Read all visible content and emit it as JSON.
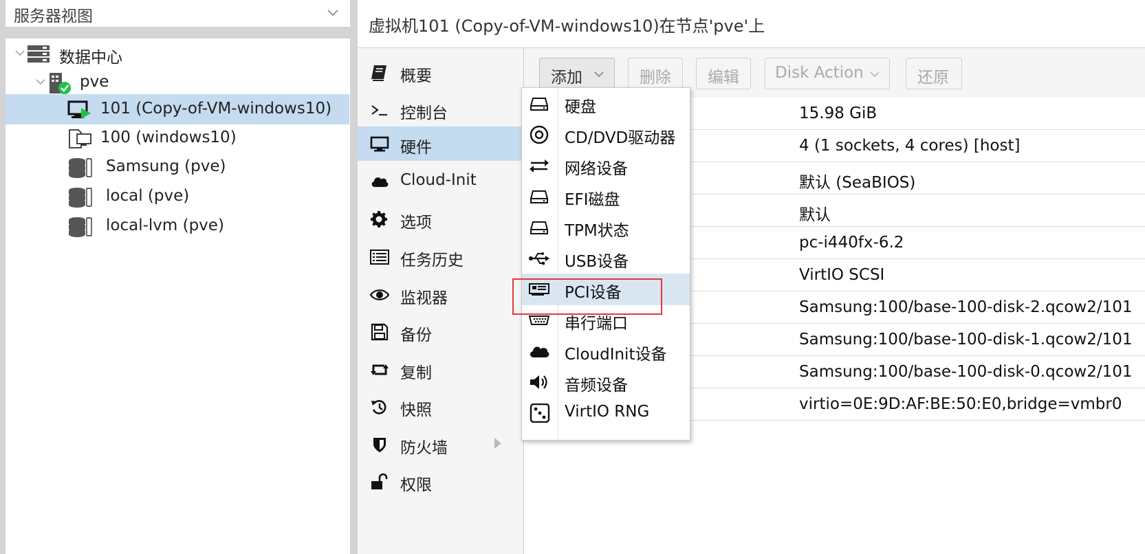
{
  "left_panel": {
    "view_selector": {
      "label": "服务器视图"
    },
    "tree": [
      {
        "label": "数据中心",
        "icon": "datacenter-icon"
      },
      {
        "label": "pve",
        "icon": "node-online-icon"
      },
      {
        "label": "101 (Copy-of-VM-windows10)",
        "icon": "vm-running-icon",
        "selected": true
      },
      {
        "label": "100 (windows10)",
        "icon": "vm-template-icon"
      },
      {
        "label": "Samsung (pve)",
        "icon": "storage-icon"
      },
      {
        "label": "local (pve)",
        "icon": "storage-icon"
      },
      {
        "label": "local-lvm (pve)",
        "icon": "storage-icon"
      }
    ]
  },
  "header": {
    "title": "虚拟机101 (Copy-of-VM-windows10)在节点'pve'上"
  },
  "nav": {
    "items": [
      {
        "label": "概要",
        "icon": "book-icon"
      },
      {
        "label": "控制台",
        "icon": "terminal-icon"
      },
      {
        "label": "硬件",
        "icon": "desktop-icon",
        "active": true
      },
      {
        "label": "Cloud-Init",
        "icon": "cloud-icon"
      },
      {
        "label": "选项",
        "icon": "gear-icon"
      },
      {
        "label": "任务历史",
        "icon": "list-icon"
      },
      {
        "label": "监视器",
        "icon": "eye-icon"
      },
      {
        "label": "备份",
        "icon": "floppy-icon"
      },
      {
        "label": "复制",
        "icon": "retweet-icon"
      },
      {
        "label": "快照",
        "icon": "history-icon"
      },
      {
        "label": "防火墙",
        "icon": "shield-icon"
      },
      {
        "label": "权限",
        "icon": "unlock-icon"
      }
    ]
  },
  "toolbar": {
    "add_label": "添加",
    "delete_label": "删除",
    "edit_label": "编辑",
    "disk_action_label": "Disk Action",
    "revert_label": "还原"
  },
  "hardware_values": [
    "15.98 GiB",
    "4 (1 sockets, 4 cores) [host]",
    "默认 (SeaBIOS)",
    "默认",
    "pc-i440fx-6.2",
    "VirtIO SCSI",
    "Samsung:100/base-100-disk-2.qcow2/101",
    "Samsung:100/base-100-disk-1.qcow2/101",
    "Samsung:100/base-100-disk-0.qcow2/101",
    "virtio=0E:9D:AF:BE:50:E0,bridge=vmbr0"
  ],
  "add_menu": {
    "items": [
      {
        "label": "硬盘",
        "icon": "hdd-icon"
      },
      {
        "label": "CD/DVD驱动器",
        "icon": "disc-icon"
      },
      {
        "label": "网络设备",
        "icon": "exchange-icon"
      },
      {
        "label": "EFI磁盘",
        "icon": "hdd-icon"
      },
      {
        "label": "TPM状态",
        "icon": "hdd-icon"
      },
      {
        "label": "USB设备",
        "icon": "usb-icon"
      },
      {
        "label": "PCI设备",
        "icon": "pci-card-icon",
        "highlighted": true
      },
      {
        "label": "串行端口",
        "icon": "serial-port-icon"
      },
      {
        "label": "CloudInit设备",
        "icon": "cloud-icon"
      },
      {
        "label": "音频设备",
        "icon": "volume-icon"
      },
      {
        "label": "VirtIO RNG",
        "icon": "dice-icon"
      }
    ]
  },
  "colors": {
    "selection": "#c5dbef",
    "menu_hover": "#d9e6f2",
    "annotation_box": "#e53935",
    "online_badge": "#21bf4b"
  }
}
